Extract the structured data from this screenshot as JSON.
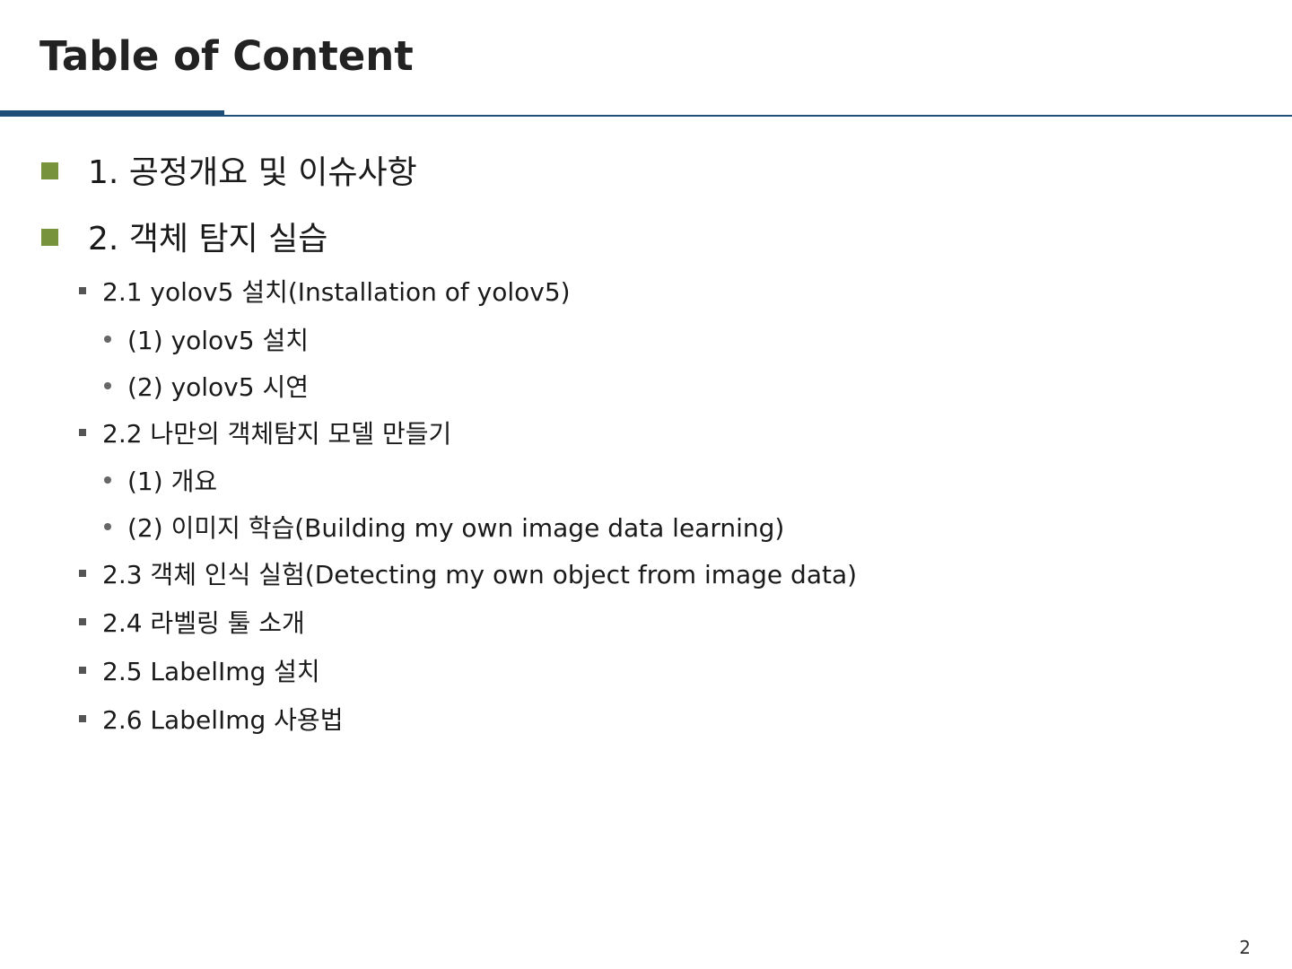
{
  "slide": {
    "title": "Table of Content",
    "page_number": "2"
  },
  "colors": {
    "accent_rule": "#1f4e79",
    "level1_bullet": "#77933c"
  },
  "toc": [
    {
      "level": 1,
      "bullet": "square-bullet-green",
      "text": "1. 공정개요 및 이슈사항"
    },
    {
      "level": 1,
      "bullet": "square-bullet-green",
      "text": "2. 객체 탐지 실습"
    },
    {
      "level": 2,
      "bullet": "small-square-bullet",
      "text": "2.1 yolov5 설치(Installation of yolov5)"
    },
    {
      "level": 3,
      "bullet": "dot-bullet",
      "text": "(1) yolov5 설치"
    },
    {
      "level": 3,
      "bullet": "dot-bullet",
      "text": "(2) yolov5 시연"
    },
    {
      "level": 2,
      "bullet": "small-square-bullet",
      "text": "2.2 나만의 객체탐지 모델 만들기"
    },
    {
      "level": 3,
      "bullet": "dot-bullet",
      "text": "(1) 개요"
    },
    {
      "level": 3,
      "bullet": "dot-bullet",
      "text": "(2) 이미지 학습(Building my own image data learning)"
    },
    {
      "level": 2,
      "bullet": "small-square-bullet",
      "text": "2.3 객체 인식 실험(Detecting my own object from image data)"
    },
    {
      "level": 2,
      "bullet": "small-square-bullet",
      "text": "2.4 라벨링 툴 소개"
    },
    {
      "level": 2,
      "bullet": "small-square-bullet",
      "text": "2.5 LabelImg 설치"
    },
    {
      "level": 2,
      "bullet": "small-square-bullet",
      "text": "2.6 LabelImg 사용법"
    }
  ]
}
